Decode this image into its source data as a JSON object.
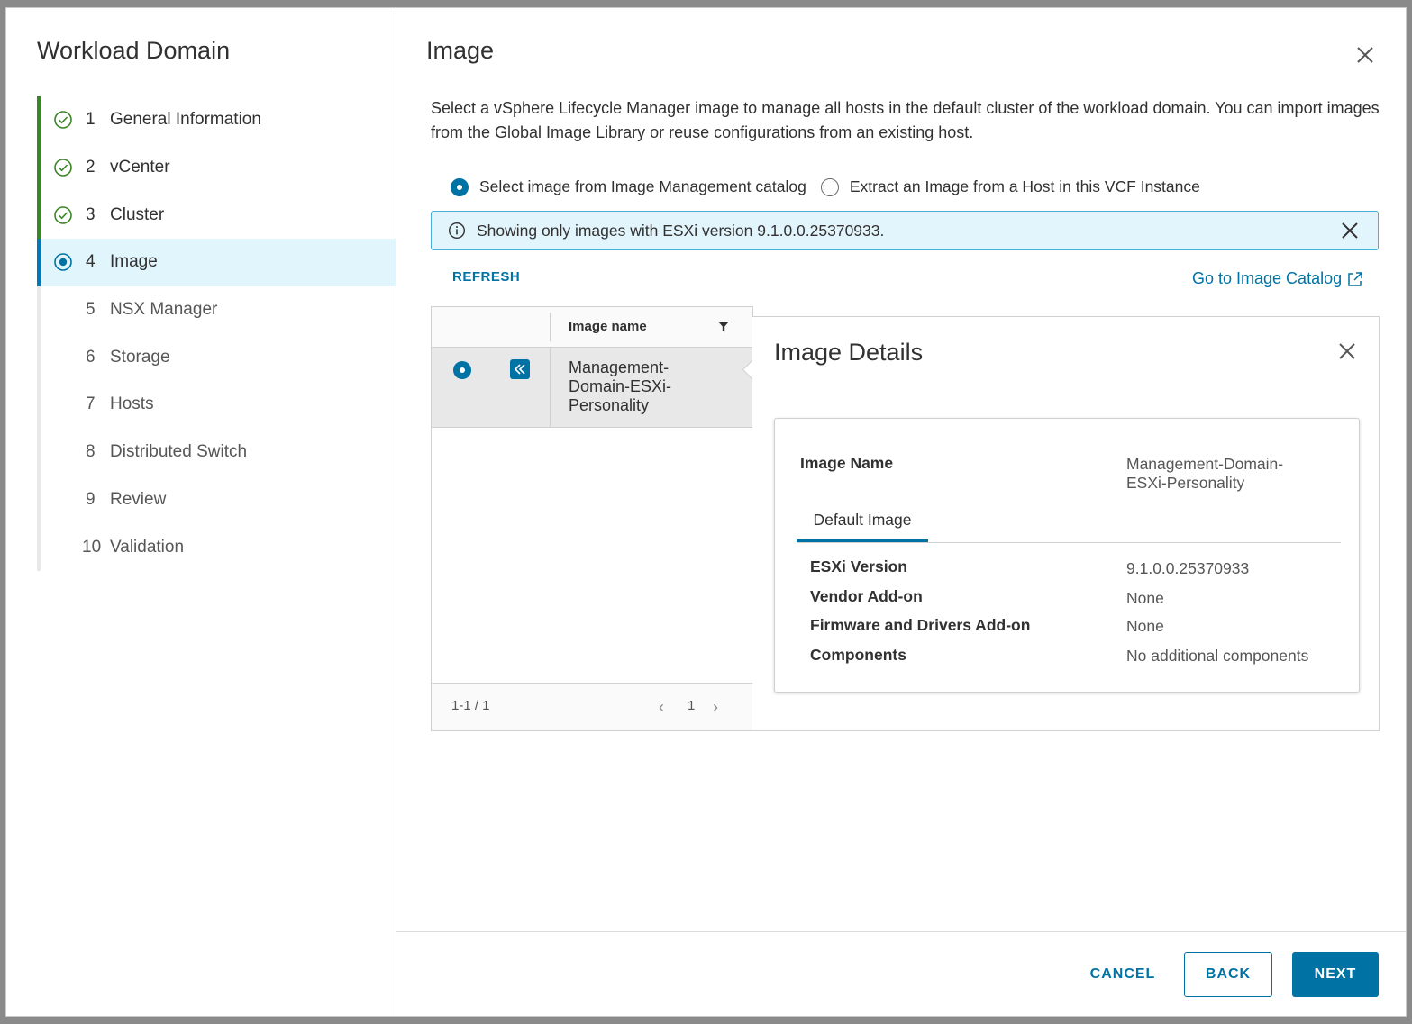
{
  "wizard": {
    "title": "Workload Domain",
    "steps": [
      {
        "num": "1",
        "label": "General Information",
        "state": "done"
      },
      {
        "num": "2",
        "label": "vCenter",
        "state": "done"
      },
      {
        "num": "3",
        "label": "Cluster",
        "state": "done"
      },
      {
        "num": "4",
        "label": "Image",
        "state": "current"
      },
      {
        "num": "5",
        "label": "NSX Manager",
        "state": "future"
      },
      {
        "num": "6",
        "label": "Storage",
        "state": "future"
      },
      {
        "num": "7",
        "label": "Hosts",
        "state": "future"
      },
      {
        "num": "8",
        "label": "Distributed Switch",
        "state": "future"
      },
      {
        "num": "9",
        "label": "Review",
        "state": "future"
      },
      {
        "num": "10",
        "label": "Validation",
        "state": "future"
      }
    ]
  },
  "page": {
    "title": "Image",
    "description": "Select a vSphere Lifecycle Manager image to manage all hosts in the default cluster of the workload domain. You can import images from the Global Image Library or reuse configurations from an existing host.",
    "radio_options": [
      {
        "label": "Select image from Image Management catalog",
        "selected": true
      },
      {
        "label": "Extract an Image from a Host in this VCF Instance",
        "selected": false
      }
    ],
    "alert": "Showing only images with ESXi version 9.1.0.0.25370933.",
    "refresh_label": "REFRESH",
    "catalog_link": "Go to Image Catalog"
  },
  "grid": {
    "column_header": "Image name",
    "rows": [
      {
        "name": "Management-Domain-ESXi-Personality",
        "name_lines": [
          "Management-",
          "Domain-ESXi-",
          "Personality"
        ],
        "selected": true
      }
    ],
    "footer_count": "1-1 / 1",
    "current_page": "1"
  },
  "details": {
    "title": "Image Details",
    "image_name_label": "Image Name",
    "image_name_value_lines": [
      "Management-Domain-",
      "ESXi-Personality"
    ],
    "tab_label": "Default Image",
    "fields": [
      {
        "label": "ESXi Version",
        "value": "9.1.0.0.25370933"
      },
      {
        "label": "Vendor Add-on",
        "value": "None"
      },
      {
        "label": "Firmware and Drivers Add-on",
        "value": "None"
      },
      {
        "label": "Components",
        "value": "No additional components"
      }
    ]
  },
  "footer": {
    "cancel": "CANCEL",
    "back": "BACK",
    "next": "NEXT"
  },
  "colors": {
    "accent": "#0072a3",
    "done_green": "#3c8527",
    "current_bg": "#e1f5fd",
    "alert_border": "#49afd9"
  }
}
